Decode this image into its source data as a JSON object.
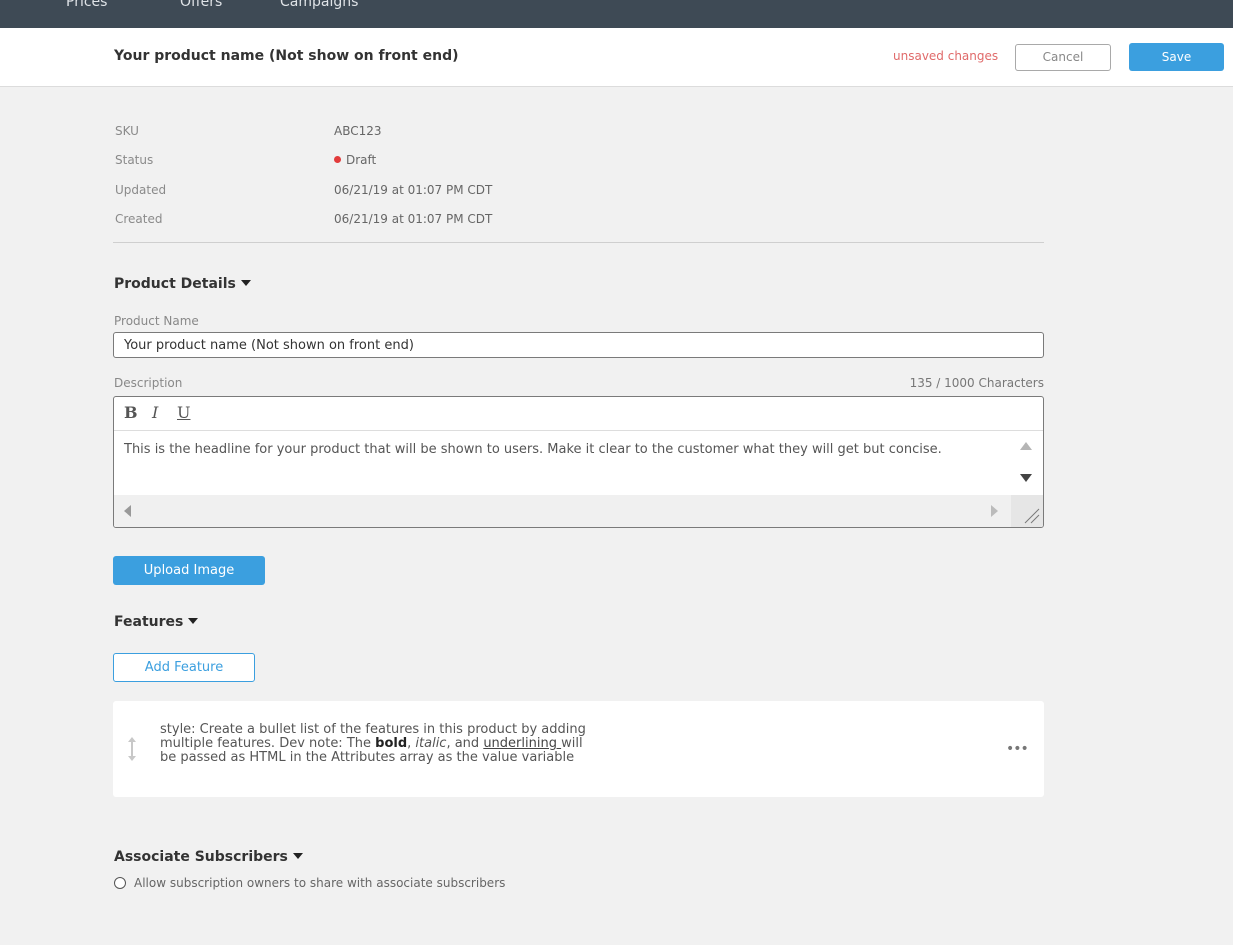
{
  "topnav": {
    "items": [
      "Prices",
      "Offers",
      "Campaigns"
    ]
  },
  "header": {
    "title": "Your product name (Not show on front end)",
    "unsaved": "unsaved changes",
    "cancel_label": "Cancel",
    "save_label": "Save"
  },
  "meta": {
    "sku_label": "SKU",
    "sku_value": "ABC123",
    "status_label": "Status",
    "status_value": "Draft",
    "updated_label": "Updated",
    "updated_value": "06/21/19 at 01:07 PM CDT",
    "created_label": "Created",
    "created_value": "06/21/19 at 01:07 PM CDT"
  },
  "product_details": {
    "title": "Product Details",
    "name_label": "Product Name",
    "name_value": "Your product name (Not shown on front end)",
    "description_label": "Description",
    "char_count": "135 / 1000 Characters",
    "toolbar": {
      "bold": "B",
      "italic": "I",
      "underline": "U"
    },
    "description_text": "This is the headline for your product that will be shown to users. Make it clear to the customer what they will get but concise.",
    "upload_label": "Upload Image"
  },
  "features": {
    "title": "Features",
    "add_label": "Add Feature",
    "item": {
      "line1": "style: Create a bullet list of the features in this product by adding",
      "line2_a": "multiple features.  Dev note: The ",
      "bold": "bold",
      "comma1": ", ",
      "italic": "italic",
      "comma2": ", and ",
      "underline": "underlining ",
      "line2_b": "will",
      "line3": "be passed as HTML in the Attributes array as the value variable",
      "more": "•••"
    }
  },
  "associate": {
    "title": "Associate Subscribers",
    "checkbox_label": "Allow subscription owners to share with associate subscribers"
  },
  "colors": {
    "accent": "#3b9fdf",
    "nav_bg": "#3e4a55",
    "unsaved": "#e06a6a",
    "status_draft": "#e23b3b"
  }
}
